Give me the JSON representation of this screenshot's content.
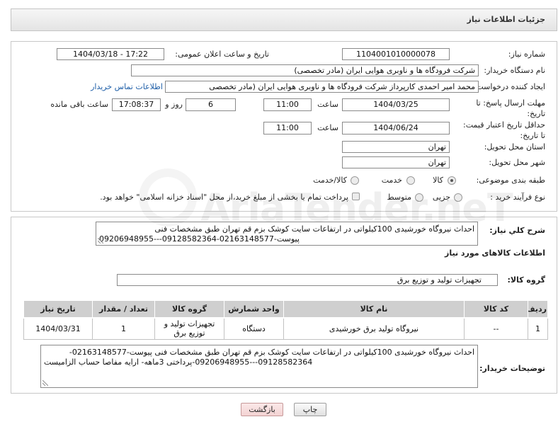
{
  "page": {
    "title": "جزئیات اطلاعات نیاز"
  },
  "watermark_text": "AriaTender.neT",
  "colors": {
    "link": "#1f5fa8",
    "back_button": "#f3d3d3",
    "header_bar": "#e4e4e4",
    "table_header": "#cfcfcf"
  },
  "details": {
    "need_number": {
      "label": "شماره نیاز:",
      "value": "1104001010000078"
    },
    "announce": {
      "label": "تاریخ و ساعت اعلان عمومی:",
      "value": "1404/03/18 - 17:22"
    },
    "buyer_org": {
      "label": "نام دستگاه خریدار:",
      "value": "شرکت فرودگاه ها و ناوبری هوایی ایران (مادر تخصصی)"
    },
    "requester": {
      "label": "ایجاد کننده درخواست:",
      "value": "محمد امیر احمدی کارپرداز شرکت فرودگاه ها و ناوبری هوایی ایران (مادر تخصصی",
      "contact_link": "اطلاعات تماس خریدار"
    },
    "deadline": {
      "label_line1": "مهلت ارسال پاسخ: تا",
      "label_line2": "تاریخ:",
      "date": "1404/03/25",
      "time_label": "ساعت",
      "time": "11:00",
      "days": "6",
      "days_label": "روز و",
      "remaining": "17:08:37",
      "remaining_label": "ساعت باقی مانده"
    },
    "price_validity": {
      "label_line1": "حداقل تاریخ اعتبار قیمت:",
      "label_line2": "تا تاریخ:",
      "date": "1404/06/24",
      "time_label": "ساعت",
      "time": "11:00"
    },
    "province": {
      "label": "استان محل تحویل:",
      "value": "تهران"
    },
    "city": {
      "label": "شهر محل تحویل:",
      "value": "تهران"
    },
    "category": {
      "label": "طبقه بندی موضوعی:",
      "options": [
        "کالا",
        "خدمت",
        "کالا/خدمت"
      ],
      "selected": "کالا"
    },
    "process": {
      "label": "نوع فرآیند خرید :",
      "options": [
        "جزیی",
        "متوسط"
      ],
      "treasury_checkbox_label": "پرداخت تمام یا بخشی از مبلغ خرید،از محل \"اسناد خزانه اسلامی\" خواهد بود.",
      "treasury_checked": false
    }
  },
  "need": {
    "summary_label": "شرح کلي نياز:",
    "summary_text": "احداث نیروگاه خورشیدی 100کیلواتی در ارتفاعات سایت کوشک بزم قم تهران طبق مشخصات فنی پیوست-02163148577-09128582364---09206948955",
    "items_heading": "اطلاعات کالاهای مورد نیاز",
    "goods_group_label": "گروه کالا:",
    "goods_group_value": "تجهیزات تولید و توزیع برق",
    "table": {
      "columns": [
        "ردیف",
        "کد کالا",
        "نام کالا",
        "واحد شمارش",
        "گروه کالا",
        "تعداد / مقدار",
        "تاریخ نیاز"
      ],
      "rows": [
        [
          "1",
          "--",
          "نیروگاه تولید برق خورشیدی",
          "دستگاه",
          "تجهیزات تولید و توزیع برق",
          "1",
          "1404/03/31"
        ]
      ]
    },
    "buyer_notes_label": "توضیحات خریدار:",
    "buyer_notes_text": "احداث نیروگاه خورشیدی 100کیلواتی در ارتفاعات سایت کوشک بزم قم تهران طبق مشخصات فنی پیوست-02163148577-09128582364---09206948955-پرداختی 3ماهه- ارایه مفاصا حساب الزامیست"
  },
  "buttons": {
    "print": "چاپ",
    "back": "بازگشت"
  }
}
